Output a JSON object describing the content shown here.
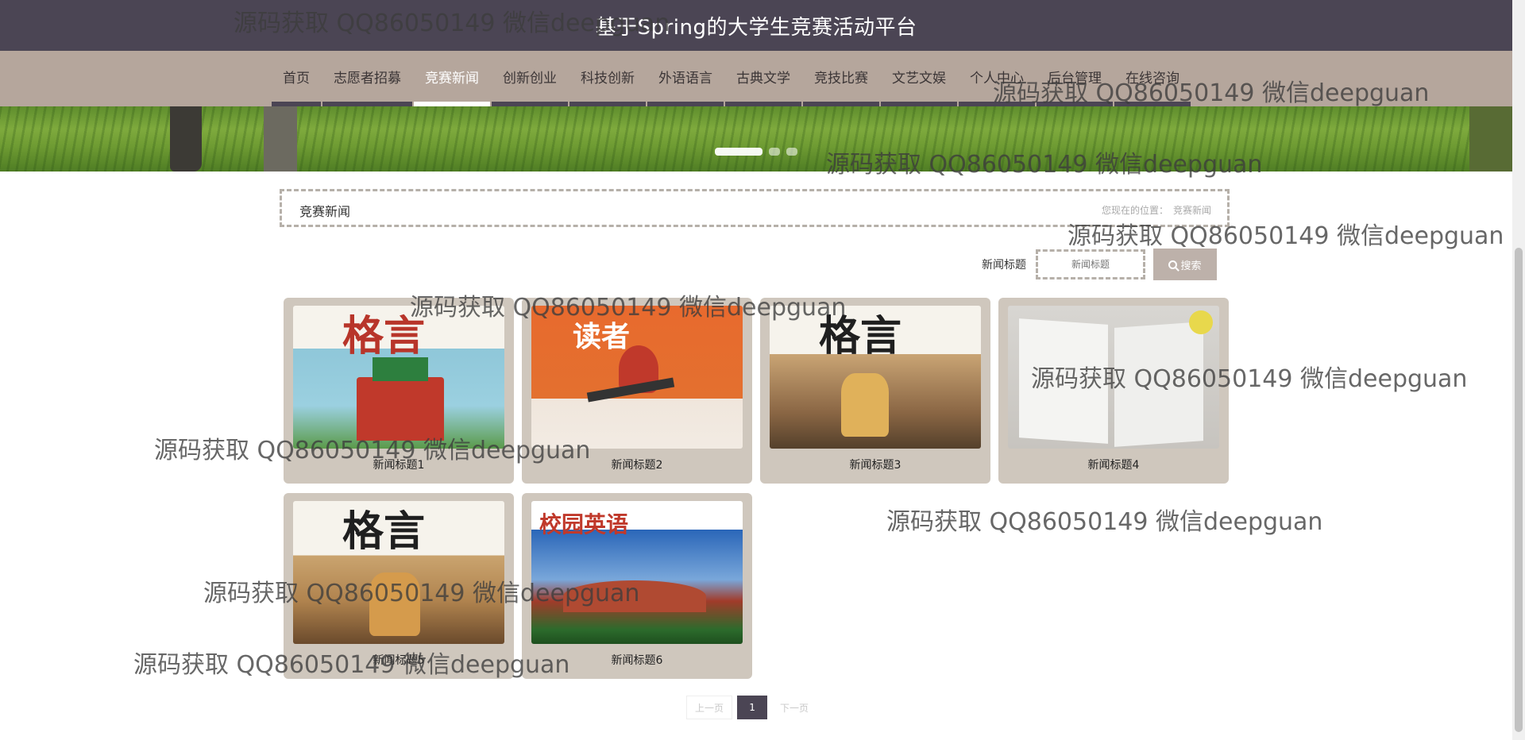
{
  "header": {
    "site_title": "基于Spring的大学生竞赛活动平台"
  },
  "nav": {
    "items": [
      {
        "label": "首页",
        "active": false
      },
      {
        "label": "志愿者招募",
        "active": false
      },
      {
        "label": "竞赛新闻",
        "active": true
      },
      {
        "label": "创新创业",
        "active": false
      },
      {
        "label": "科技创新",
        "active": false
      },
      {
        "label": "外语语言",
        "active": false
      },
      {
        "label": "古典文学",
        "active": false
      },
      {
        "label": "竞技比赛",
        "active": false
      },
      {
        "label": "文艺文娱",
        "active": false
      },
      {
        "label": "个人中心",
        "active": false
      },
      {
        "label": "后台管理",
        "active": false
      },
      {
        "label": "在线咨询",
        "active": false
      }
    ]
  },
  "banner": {
    "slides": 3,
    "active_slide": 1
  },
  "breadcrumb": {
    "title": "竞赛新闻",
    "location_label": "您现在的位置：",
    "location_value": "竞赛新闻"
  },
  "search": {
    "label": "新闻标题",
    "placeholder": "新闻标题",
    "button_label": "搜索",
    "button_icon": "search-icon"
  },
  "news": {
    "items": [
      {
        "title": "新闻标题1",
        "cover_title": "格言"
      },
      {
        "title": "新闻标题2",
        "cover_title": "读者"
      },
      {
        "title": "新闻标题3",
        "cover_title": "格言"
      },
      {
        "title": "新闻标题4",
        "cover_title": ""
      },
      {
        "title": "新闻标题5",
        "cover_title": "格言"
      },
      {
        "title": "新闻标题6",
        "cover_title": "校园英语"
      }
    ]
  },
  "pagination": {
    "prev": "上一页",
    "current": "1",
    "next": "下一页"
  },
  "watermark": {
    "text": "源码获取 QQ86050149 微信deepguan"
  },
  "colors": {
    "header_bg": "#4b4554",
    "nav_bg": "#b5a69c",
    "card_bg": "#cfc7bd",
    "accent": "#4b4554"
  }
}
